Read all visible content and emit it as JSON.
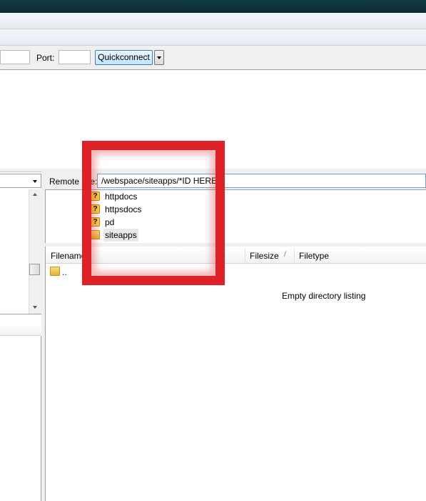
{
  "quickconnect": {
    "port_label": "Port:",
    "port_value": "",
    "button_label": "Quickconnect"
  },
  "remote": {
    "label": "Remote site:",
    "path": "/webspace/siteapps/*ID HERE*",
    "tree": [
      {
        "label": "httpdocs",
        "icon": "unknown-folder-icon"
      },
      {
        "label": "httpsdocs",
        "icon": "unknown-folder-icon"
      },
      {
        "label": "pd",
        "icon": "unknown-folder-icon"
      },
      {
        "label": "siteapps",
        "icon": "folder-icon",
        "selected": true
      }
    ]
  },
  "filelist": {
    "columns": [
      "Filename",
      "Filesize",
      "Filetype"
    ],
    "sort_indicator": "/",
    "rows": [
      {
        "name": ".."
      }
    ],
    "empty_message": "Empty directory listing"
  },
  "colors": {
    "highlight": "#dc2226",
    "titlebar": "#0b2a31"
  }
}
